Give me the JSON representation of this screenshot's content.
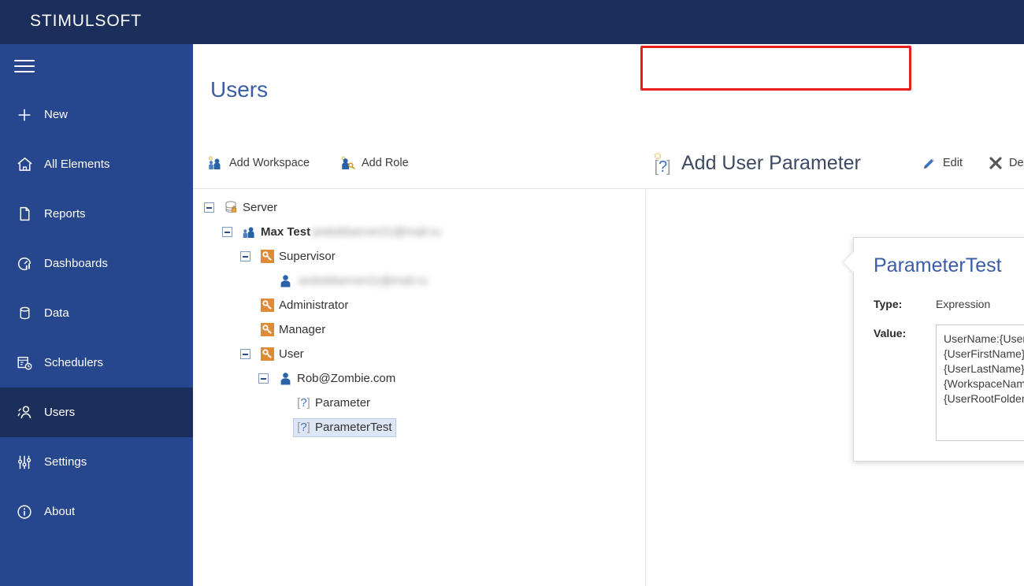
{
  "app": {
    "brand": "STIMULSOFT",
    "brand_bg": "#1b2e5c",
    "sidebar_bg": "#26478d",
    "sidebar_active_bg": "#1b2e5c",
    "accent": "#3b5ca8",
    "highlight_border": "#e81d1d"
  },
  "sidebar": {
    "menu_icon": "hamburger-icon",
    "items": [
      {
        "label": "New",
        "icon": "plus-icon",
        "active": false
      },
      {
        "label": "All Elements",
        "icon": "home-icon",
        "active": false
      },
      {
        "label": "Reports",
        "icon": "document-icon",
        "active": false
      },
      {
        "label": "Dashboards",
        "icon": "gauge-icon",
        "active": false
      },
      {
        "label": "Data",
        "icon": "database-icon",
        "active": false
      },
      {
        "label": "Schedulers",
        "icon": "calendar-clock-icon",
        "active": false
      },
      {
        "label": "Users",
        "icon": "users-icon",
        "active": true
      },
      {
        "label": "Settings",
        "icon": "sliders-icon",
        "active": false
      },
      {
        "label": "About",
        "icon": "info-icon",
        "active": false
      }
    ]
  },
  "main": {
    "title": "Users"
  },
  "toolbar": {
    "buttons": [
      {
        "label": "Add Workspace",
        "icon": "add-workspace-icon",
        "highlighted": false
      },
      {
        "label": "Add Role",
        "icon": "add-role-icon",
        "highlighted": false
      },
      {
        "label": "Add User Parameter",
        "icon": "parameter-icon",
        "highlighted": true
      },
      {
        "label": "Edit",
        "icon": "pencil-icon",
        "highlighted": false
      },
      {
        "label": "Delete",
        "icon": "cross-icon",
        "highlighted": false
      }
    ]
  },
  "tree": {
    "nodes": [
      {
        "label": "Server",
        "icon": "database-lock-icon",
        "indent": 0,
        "expander": "minus",
        "bold": false,
        "selected": false,
        "blurred_suffix": ""
      },
      {
        "label": "Max Test",
        "icon": "workspace-users-icon",
        "indent": 1,
        "expander": "minus",
        "bold": true,
        "selected": false,
        "blurred_suffix": "andoldserver21@mail.ru"
      },
      {
        "label": "Supervisor",
        "icon": "role-key-icon",
        "indent": 2,
        "expander": "minus",
        "bold": false,
        "selected": false,
        "blurred_suffix": ""
      },
      {
        "label": "",
        "icon": "user-icon",
        "indent": 3,
        "expander": "none",
        "bold": false,
        "selected": false,
        "blurred_suffix": "andoldserver21@mail.ru"
      },
      {
        "label": "Administrator",
        "icon": "role-key-icon",
        "indent": 2,
        "expander": "none",
        "bold": false,
        "selected": false,
        "blurred_suffix": ""
      },
      {
        "label": "Manager",
        "icon": "role-key-icon",
        "indent": 2,
        "expander": "none",
        "bold": false,
        "selected": false,
        "blurred_suffix": ""
      },
      {
        "label": "User",
        "icon": "role-key-icon",
        "indent": 2,
        "expander": "minus",
        "bold": false,
        "selected": false,
        "blurred_suffix": ""
      },
      {
        "label": "Rob@Zombie.com",
        "icon": "user-icon",
        "indent": 3,
        "expander": "minus",
        "bold": false,
        "selected": false,
        "blurred_suffix": ""
      },
      {
        "label": "Parameter",
        "icon": "parameter-icon",
        "indent": 4,
        "expander": "none",
        "bold": false,
        "selected": false,
        "blurred_suffix": ""
      },
      {
        "label": "ParameterTest",
        "icon": "parameter-icon",
        "indent": 4,
        "expander": "none",
        "bold": false,
        "selected": true,
        "blurred_suffix": ""
      }
    ]
  },
  "details": {
    "title": "ParameterTest",
    "type_label": "Type:",
    "type_value": "Expression",
    "value_label": "Value:",
    "value_text": "UserName:{UserName} FirstName: {UserFirstName} LastName: {UserLastName} Workspace: {WorkspaceName} RootFolder: {UserRootFolder} Role:{UserRole}"
  }
}
